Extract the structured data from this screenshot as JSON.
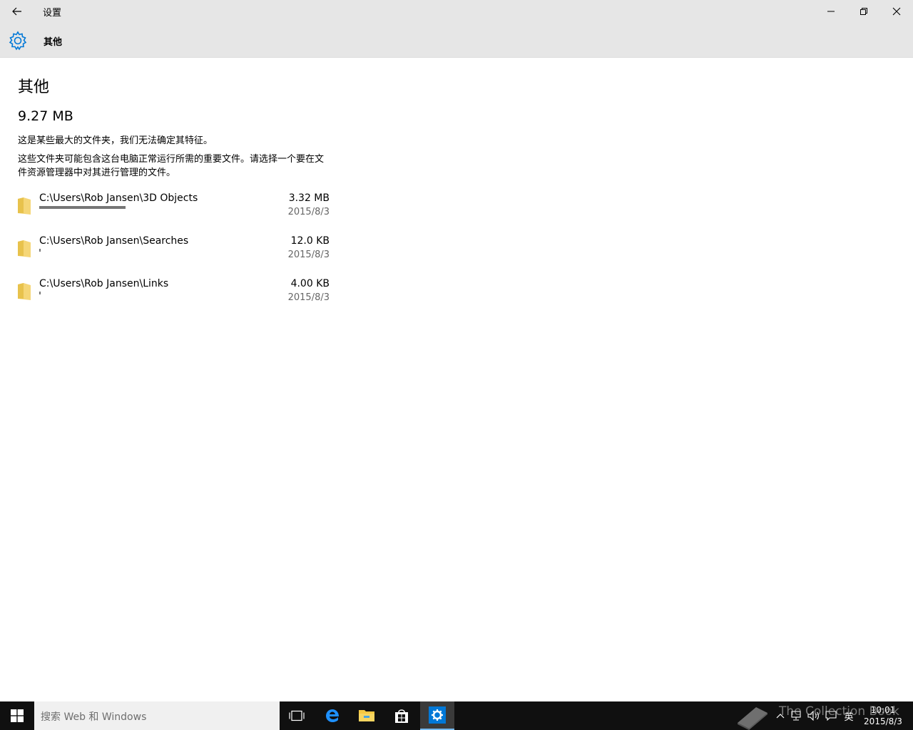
{
  "window": {
    "title": "设置"
  },
  "header": {
    "title": "其他",
    "icon": "gear-icon"
  },
  "page": {
    "title": "其他",
    "total_size": "9.27 MB",
    "description_1": "这是某些最大的文件夹，我们无法确定其特征。",
    "description_2": "这些文件夹可能包含这台电脑正常运行所需的重要文件。请选择一个要在文件资源管理器中对其进行管理的文件。"
  },
  "folders": [
    {
      "path": "C:\\Users\\Rob Jansen\\3D Objects",
      "size": "3.32 MB",
      "date": "2015/8/3",
      "usage_fraction": 0.357
    },
    {
      "path": "C:\\Users\\Rob Jansen\\Searches",
      "size": "12.0 KB",
      "date": "2015/8/3",
      "usage_fraction": 0.001
    },
    {
      "path": "C:\\Users\\Rob Jansen\\Links",
      "size": "4.00 KB",
      "date": "2015/8/3",
      "usage_fraction": 0.0004
    }
  ],
  "taskbar": {
    "search_placeholder": "搜索 Web 和 Windows",
    "language": "英",
    "clock_time": "10:01",
    "clock_date": "2015/8/3",
    "watermark": "The Collection Book"
  },
  "colors": {
    "titlebar_bg": "#e6e6e6",
    "accent": "#0078d7",
    "taskbar_bg": "#101010"
  }
}
